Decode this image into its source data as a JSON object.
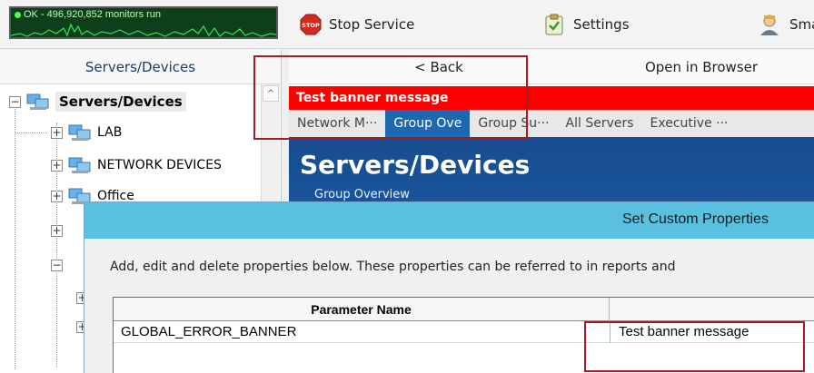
{
  "toolbar": {
    "monitor_status": "OK - 496,920,852 monitors run",
    "stop_label": "Stop Service",
    "stop_icon": "stop-icon",
    "settings_label": "Settings",
    "settings_icon": "clipboard-check-icon",
    "smart_label": "Smart",
    "smart_icon": "person-icon"
  },
  "left_pane": {
    "header": "Servers/Devices",
    "tree": [
      {
        "label": "Servers/Devices",
        "expander": "−",
        "bold": true
      },
      {
        "label": "LAB",
        "expander": "+"
      },
      {
        "label": "NETWORK DEVICES",
        "expander": "+"
      },
      {
        "label": "Office",
        "expander": "+"
      }
    ],
    "scroll_up": "^"
  },
  "right_pane": {
    "back_label": "< Back",
    "open_label": "Open in Browser",
    "banner": "Test banner message",
    "tabs": [
      "Network M···",
      "Group Ove",
      "Group Su···",
      "All Servers",
      "Executive ···"
    ],
    "active_tab_index": 1,
    "title": "Servers/Devices",
    "subtitle": "Group Overview"
  },
  "dialog": {
    "title": "Set Custom Properties",
    "description": "Add, edit and delete properties below.  These properties can be referred to in reports and",
    "column_header": "Parameter Name",
    "rows": [
      {
        "name": "GLOBAL_ERROR_BANNER",
        "value": "Test banner message"
      }
    ]
  },
  "colors": {
    "banner": "#ff0000",
    "active_tab": "#1d68b0",
    "header_blue": "#174c8f",
    "dialog_title": "#59c0e0",
    "highlight": "#a41d24"
  }
}
